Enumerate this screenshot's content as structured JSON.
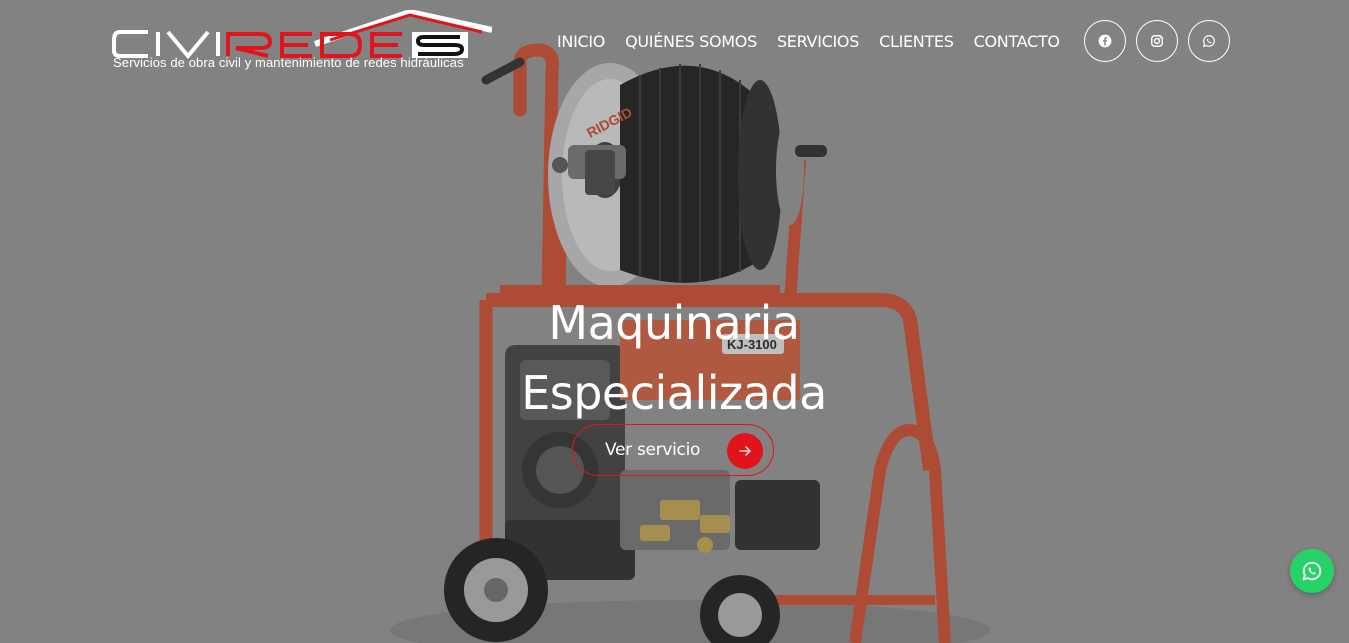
{
  "brand": {
    "logo_text": "CIVIREDES",
    "tagline": "Servicios de obra civil y mantenimiento de redes hidráulicas"
  },
  "nav": {
    "items": [
      {
        "label": "INICIO"
      },
      {
        "label": "QUIÉNES SOMOS"
      },
      {
        "label": "SERVICIOS"
      },
      {
        "label": "CLIENTES"
      },
      {
        "label": "CONTACTO"
      }
    ]
  },
  "socials": {
    "icons": [
      "facebook-icon",
      "instagram-icon",
      "whatsapp-icon"
    ]
  },
  "hero": {
    "title": "Maquinaria Especializada",
    "cta_label": "Ver servicio",
    "machine_labels": {
      "brand": "RIDGID",
      "model": "KJ-3100"
    }
  },
  "floating": {
    "icon": "whatsapp-icon"
  },
  "colors": {
    "accent": "#e1141b",
    "whatsapp": "#25d366",
    "frame": "#c8482a",
    "text": "#ffffff"
  }
}
